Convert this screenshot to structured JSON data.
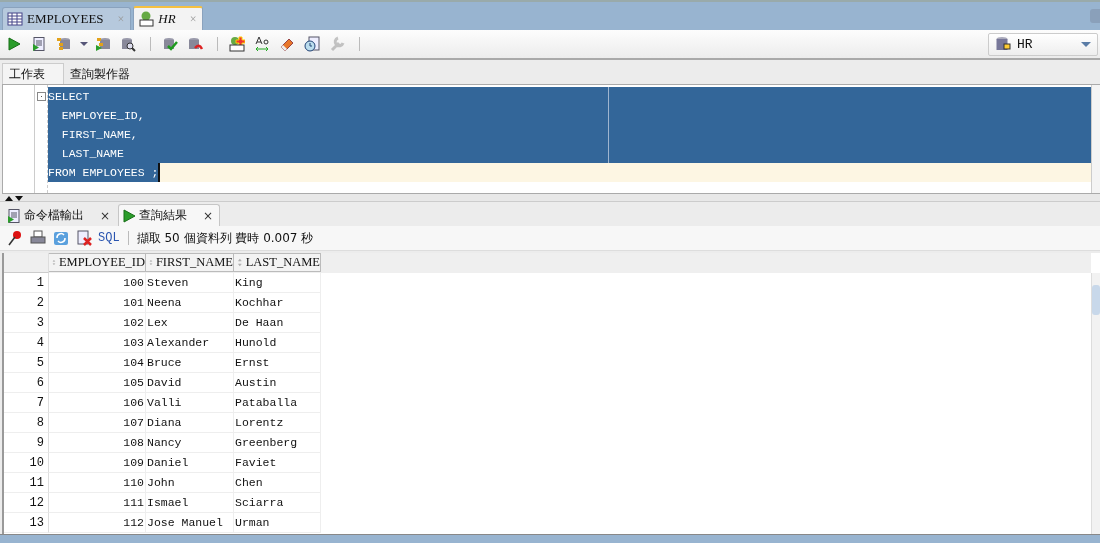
{
  "document_tabs": [
    {
      "label": "EMPLOYEES",
      "close": "×",
      "selected": false
    },
    {
      "label": "HR",
      "close": "×",
      "selected": true
    }
  ],
  "toolbar": [
    {
      "kind": "run",
      "disabled": false
    },
    {
      "kind": "script",
      "disabled": false
    },
    {
      "kind": "explain",
      "disabled": false
    },
    {
      "kind": "dropdown",
      "disabled": false
    },
    {
      "kind": "autotrace",
      "disabled": false
    },
    {
      "kind": "monitor",
      "disabled": false
    },
    {
      "kind": "separator"
    },
    {
      "kind": "commit",
      "disabled": false
    },
    {
      "kind": "rollback",
      "disabled": false
    },
    {
      "kind": "separator"
    },
    {
      "kind": "sqlcl",
      "disabled": false
    },
    {
      "kind": "case",
      "disabled": false
    },
    {
      "kind": "eraser",
      "disabled": false
    },
    {
      "kind": "history",
      "disabled": false
    },
    {
      "kind": "tune",
      "disabled": true
    },
    {
      "kind": "separator"
    }
  ],
  "connection": {
    "value": "HR"
  },
  "editor_tabs": [
    {
      "label": "工作表",
      "selected": true
    },
    {
      "label": "查詢製作器",
      "selected": false
    }
  ],
  "editor": {
    "lines": [
      {
        "text": "SELECT",
        "current": false,
        "fold": true
      },
      {
        "text": "  EMPLOYEE_ID,",
        "current": false,
        "fold": false
      },
      {
        "text": "  FIRST_NAME,",
        "current": false,
        "fold": false
      },
      {
        "text": "  LAST_NAME",
        "current": false,
        "fold": false
      },
      {
        "text": "FROM EMPLOYEES ;",
        "current": true,
        "fold": false
      }
    ]
  },
  "output_tabs": [
    {
      "label": "命令檔輸出",
      "close": "×",
      "selected": false
    },
    {
      "label": "查詢結果",
      "close": "×",
      "selected": true
    }
  ],
  "results_toolbar": {
    "sql_link": "SQL",
    "status": "擷取 50 個資料列 費時 0.007 秒"
  },
  "results": {
    "columns": [
      "",
      "EMPLOYEE_ID",
      "FIRST_NAME",
      "LAST_NAME"
    ],
    "rows": [
      [
        "1",
        "100",
        "Steven",
        "King"
      ],
      [
        "2",
        "101",
        "Neena",
        "Kochhar"
      ],
      [
        "3",
        "102",
        "Lex",
        "De Haan"
      ],
      [
        "4",
        "103",
        "Alexander",
        "Hunold"
      ],
      [
        "5",
        "104",
        "Bruce",
        "Ernst"
      ],
      [
        "6",
        "105",
        "David",
        "Austin"
      ],
      [
        "7",
        "106",
        "Valli",
        "Pataballa"
      ],
      [
        "8",
        "107",
        "Diana",
        "Lorentz"
      ],
      [
        "9",
        "108",
        "Nancy",
        "Greenberg"
      ],
      [
        "10",
        "109",
        "Daniel",
        "Faviet"
      ],
      [
        "11",
        "110",
        "John",
        "Chen"
      ],
      [
        "12",
        "111",
        "Ismael",
        "Sciarra"
      ],
      [
        "13",
        "112",
        "Jose Manuel",
        "Urman"
      ]
    ]
  }
}
